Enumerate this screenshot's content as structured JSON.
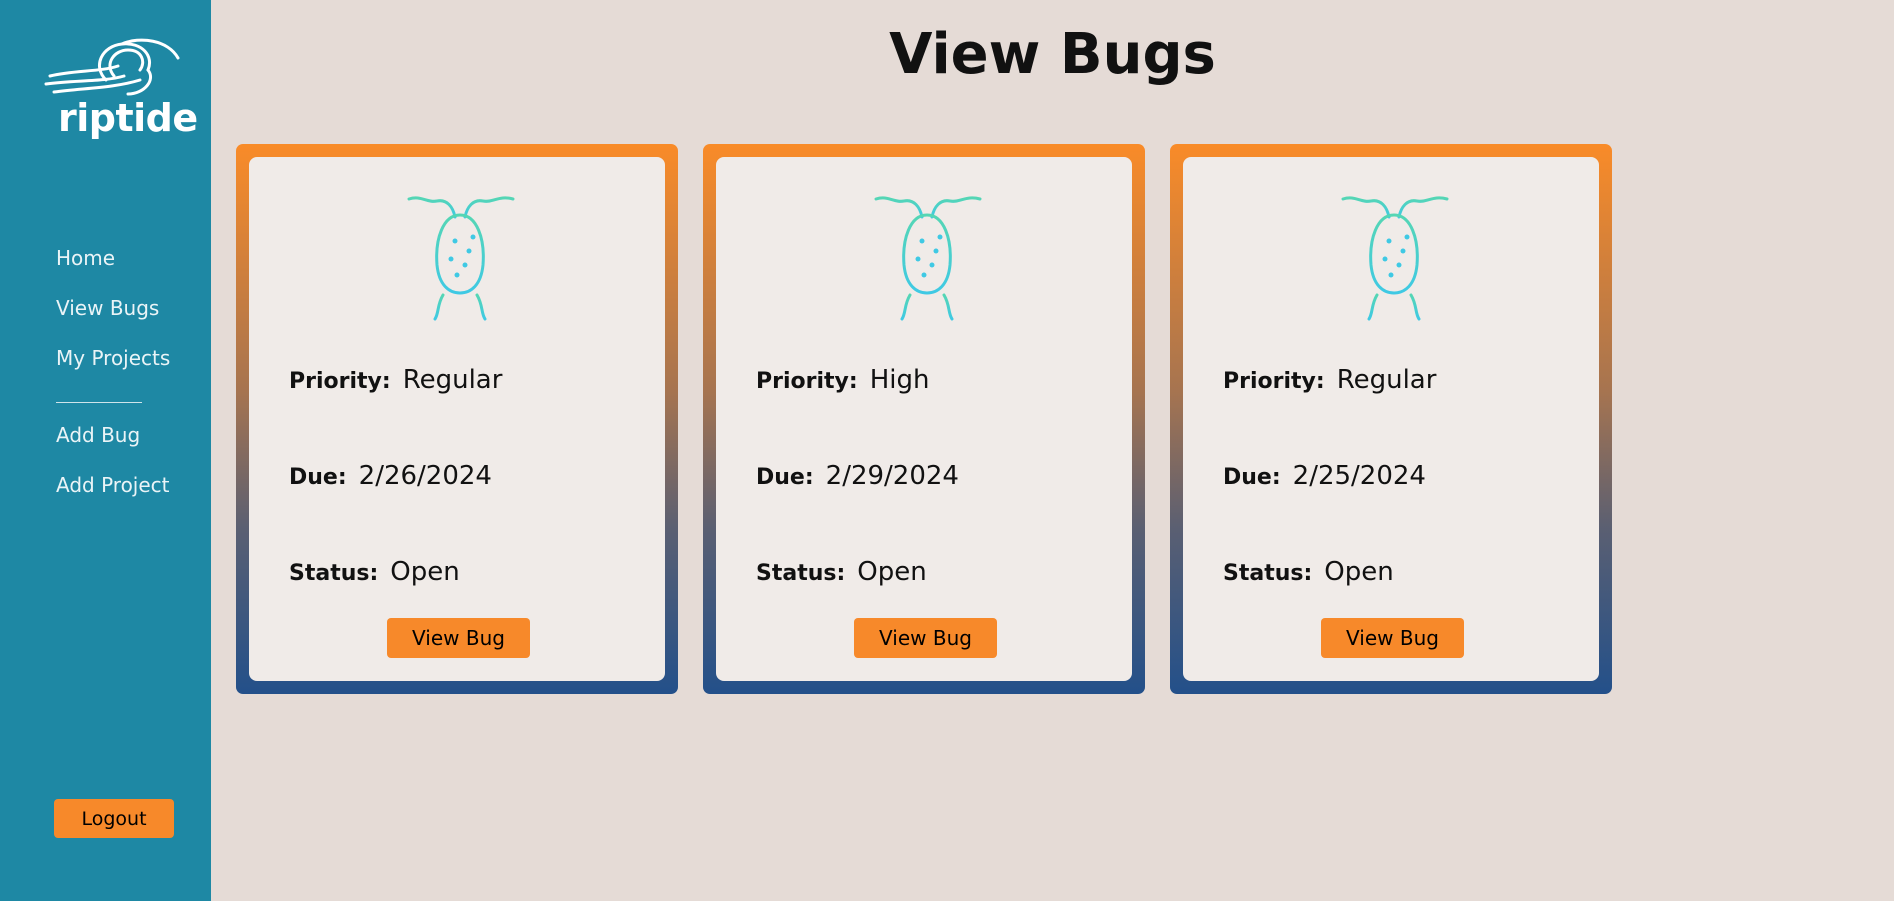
{
  "brand": {
    "name": "riptide"
  },
  "title": "View Bugs",
  "nav": {
    "items": [
      {
        "label": "Home"
      },
      {
        "label": "View Bugs"
      },
      {
        "label": "My Projects"
      }
    ],
    "actions": [
      {
        "label": "Add Bug"
      },
      {
        "label": "Add Project"
      }
    ]
  },
  "logout_label": "Logout",
  "labels": {
    "priority": "Priority:",
    "due": "Due:",
    "status": "Status:"
  },
  "cards": [
    {
      "priority": "Regular",
      "due": "2/26/2024",
      "status": "Open",
      "button": "View Bug"
    },
    {
      "priority": "High",
      "due": "2/29/2024",
      "status": "Open",
      "button": "View Bug"
    },
    {
      "priority": "Regular",
      "due": "2/25/2024",
      "status": "Open",
      "button": "View Bug"
    }
  ],
  "colors": {
    "sidebar": "#1e88a4",
    "background": "#e5dbd6",
    "accent": "#f7892a",
    "card_gradient_top": "#f98b28",
    "card_gradient_bottom": "#23508a",
    "bug_icon": "#3fcfd8"
  }
}
